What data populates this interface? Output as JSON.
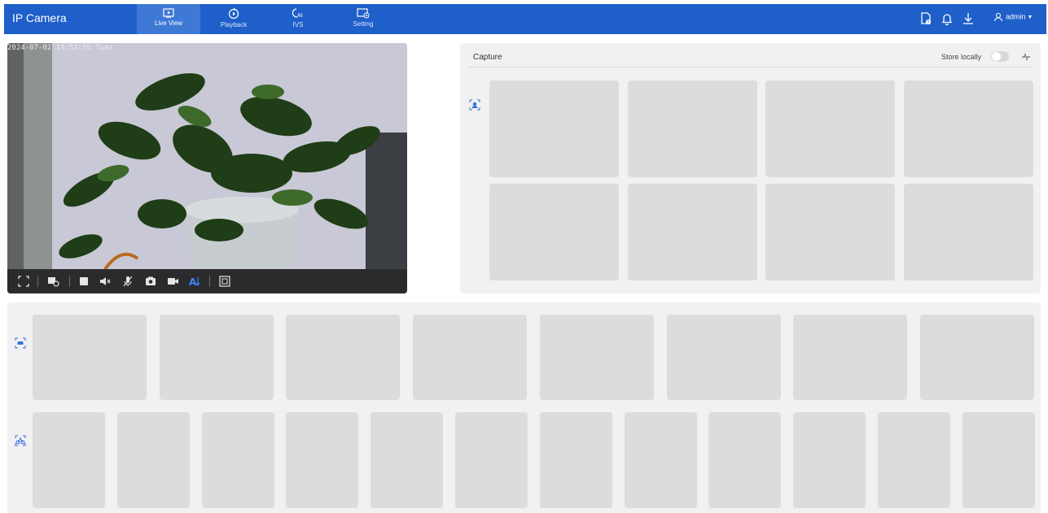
{
  "app": {
    "title": "IP Camera"
  },
  "nav": {
    "tabs": [
      {
        "label": "Live View",
        "icon": "live-view-icon",
        "active": true
      },
      {
        "label": "Playback",
        "icon": "playback-icon",
        "active": false
      },
      {
        "label": "IVS",
        "icon": "ivs-icon",
        "active": false
      },
      {
        "label": "Setting",
        "icon": "setting-icon",
        "active": false
      }
    ]
  },
  "header": {
    "user": "admin",
    "icons": [
      "report-icon",
      "bell-icon",
      "download-icon",
      "user-icon"
    ]
  },
  "live": {
    "osd_timestamp": "2024-07-02 14:52:55 Tues",
    "toolbar": [
      "fullscreen-icon",
      "stream-switch-icon",
      "stop-icon",
      "mute-icon",
      "microphone-off-icon",
      "snapshot-icon",
      "record-icon",
      "ai-overlay-icon",
      "zoom-region-icon"
    ]
  },
  "capture": {
    "title": "Capture",
    "store_locally_label": "Store locally",
    "store_locally": false,
    "kind_icon": "face-capture-icon"
  },
  "bottom": {
    "rows": [
      {
        "icon": "vehicle-capture-icon",
        "tile_count": 8
      },
      {
        "icon": "non-motor-capture-icon",
        "tile_count": 12
      }
    ]
  },
  "colors": {
    "brand": "#1f5fc9",
    "active_tab": "#3f79d6",
    "panel": "#f1f1f1",
    "tile": "#dcdcdc",
    "accent": "#2f6fe0"
  }
}
